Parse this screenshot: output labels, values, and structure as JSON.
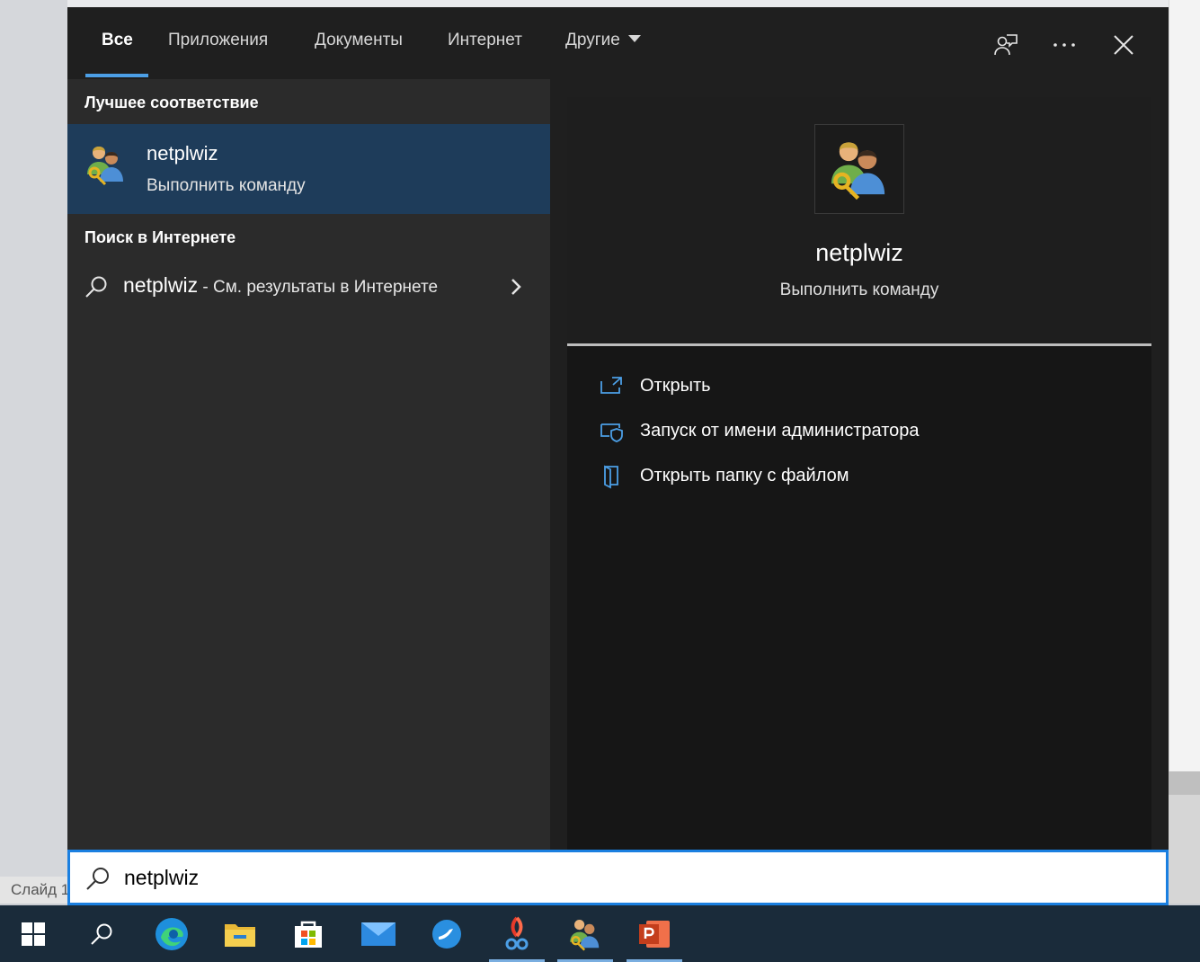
{
  "background": {
    "status_text": "Слайд 1"
  },
  "tabs": [
    {
      "label": "Все",
      "active": true
    },
    {
      "label": "Приложения",
      "active": false
    },
    {
      "label": "Документы",
      "active": false
    },
    {
      "label": "Интернет",
      "active": false
    },
    {
      "label": "Другие",
      "active": false
    }
  ],
  "toolbar_icons": [
    "feedback-icon",
    "more-icon",
    "close-icon"
  ],
  "best_match": {
    "heading": "Лучшее соответствие",
    "title": "netplwiz",
    "subtitle": "Выполнить команду",
    "icon": "users-key-icon"
  },
  "web_search": {
    "heading": "Поиск в Интернете",
    "query": "netplwiz",
    "suffix": " - См. результаты в Интернете"
  },
  "preview": {
    "title": "netplwiz",
    "subtitle": "Выполнить команду",
    "actions": [
      {
        "label": "Открыть",
        "icon": "open-icon"
      },
      {
        "label": "Запуск от имени администратора",
        "icon": "admin-shield-icon"
      },
      {
        "label": "Открыть папку с файлом",
        "icon": "folder-location-icon"
      }
    ]
  },
  "search": {
    "value": "netplwiz"
  },
  "taskbar": {
    "items": [
      "windows-start-icon",
      "search-icon",
      "edge-icon",
      "file-explorer-icon",
      "store-icon",
      "mail-icon",
      "bird-app-icon",
      "snipping-icon",
      "netplwiz-icon",
      "powerpoint-icon"
    ]
  },
  "colors": {
    "accent": "#1a7fe0",
    "selected_row": "#1e3c5a",
    "tab_underline": "#4c9fe6"
  }
}
